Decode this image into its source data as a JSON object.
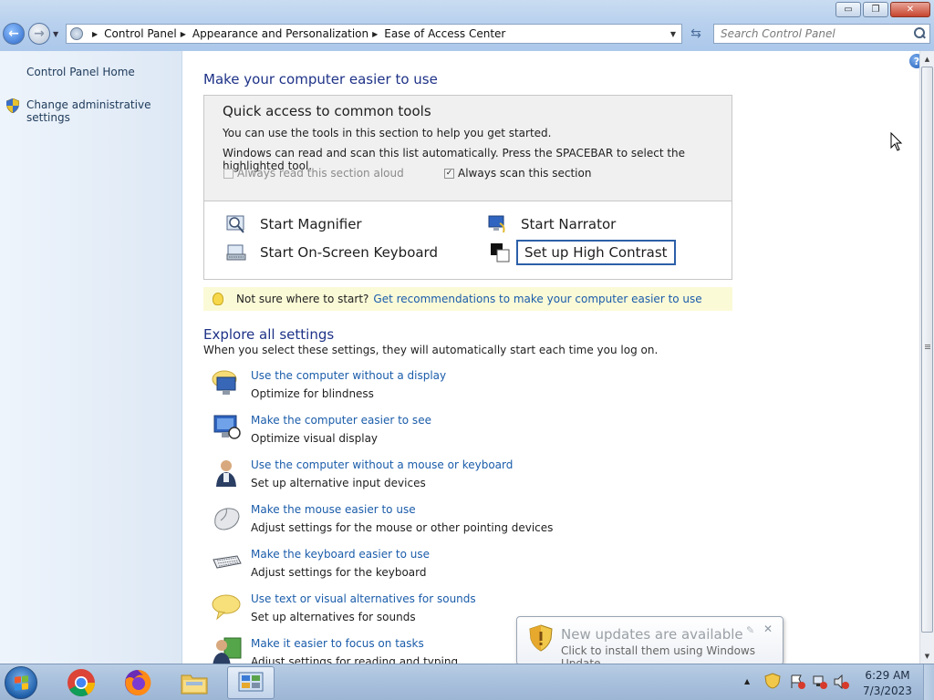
{
  "window": {
    "buttons": {
      "minimize": "▭",
      "maximize": "❐",
      "close": "✕"
    }
  },
  "address_bar": {
    "breadcrumbs": [
      "Control Panel",
      "Appearance and Personalization",
      "Ease of Access Center"
    ],
    "search_placeholder": "Search Control Panel"
  },
  "sidebar": {
    "items": [
      {
        "label": "Control Panel Home"
      },
      {
        "label": "Change administrative settings",
        "icon": "shield-icon"
      }
    ]
  },
  "main": {
    "heading": "Make your computer easier to use",
    "quick_access": {
      "title": "Quick access to common tools",
      "line1": "You can use the tools in this section to help you get started.",
      "line2": "Windows can read and scan this list automatically.  Press the SPACEBAR to select the highlighted tool.",
      "read_aloud_label": "Always read this section aloud",
      "read_aloud_checked": false,
      "scan_label": "Always scan this section",
      "scan_checked": true,
      "tools": [
        {
          "label": "Start Magnifier",
          "icon": "magnifier-icon"
        },
        {
          "label": "Start Narrator",
          "icon": "narrator-icon"
        },
        {
          "label": "Start On-Screen Keyboard",
          "icon": "keyboard-icon"
        },
        {
          "label": "Set up High Contrast",
          "icon": "high-contrast-icon"
        }
      ]
    },
    "tip": {
      "text": "Not sure where to start?",
      "link": "Get recommendations to make your computer easier to use"
    },
    "explore_heading": "Explore all settings",
    "explore_sub": "When you select these settings, they will automatically start each time you log on.",
    "settings": [
      {
        "link": "Use the computer without a display",
        "desc": "Optimize for blindness",
        "icon": "monitor-speaker-icon"
      },
      {
        "link": "Make the computer easier to see",
        "desc": "Optimize visual display",
        "icon": "monitor-icon"
      },
      {
        "link": "Use the computer without a mouse or keyboard",
        "desc": "Set up alternative input devices",
        "icon": "person-icon"
      },
      {
        "link": "Make the mouse easier to use",
        "desc": "Adjust settings for the mouse or other pointing devices",
        "icon": "mouse-icon"
      },
      {
        "link": "Make the keyboard easier to use",
        "desc": "Adjust settings for the keyboard",
        "icon": "keyboard-icon"
      },
      {
        "link": "Use text or visual alternatives for sounds",
        "desc": "Set up alternatives for sounds",
        "icon": "speech-bubble-icon"
      },
      {
        "link": "Make it easier to focus on tasks",
        "desc": "Adjust settings for reading and typing",
        "icon": "focus-person-icon"
      }
    ]
  },
  "notification": {
    "title": "New updates are available",
    "subtitle": "Click to install them using Windows Update."
  },
  "taskbar": {
    "apps": [
      "chrome-icon",
      "firefox-icon",
      "explorer-icon",
      "control-panel-icon"
    ],
    "time": "6:29 AM",
    "date": "7/3/2023"
  },
  "colors": {
    "link": "#1a5caa",
    "heading": "#1e3287",
    "tip_background": "#fbfad7",
    "focus_border": "#2b5fa8"
  }
}
